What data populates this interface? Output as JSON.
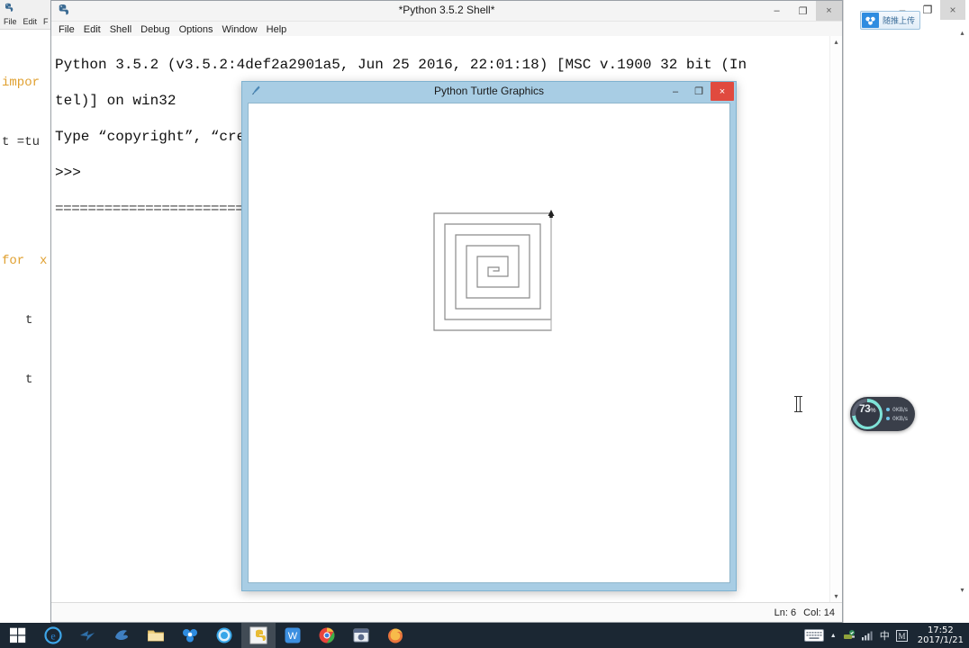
{
  "editor_window": {
    "title": "",
    "icon": "python-idle-icon",
    "menu": [
      "File",
      "Edit",
      "F"
    ],
    "code_lines": [
      {
        "text": "impor",
        "kw": true
      },
      {
        "text": "t =tu",
        "kw": false
      },
      {
        "text": "",
        "kw": false
      },
      {
        "text": "for  x",
        "kw": true
      },
      {
        "text": "t",
        "kw": false,
        "indent": true
      },
      {
        "text": "t",
        "kw": false,
        "indent": true
      }
    ]
  },
  "shell_window": {
    "icon": "python-idle-icon",
    "title": "*Python 3.5.2 Shell*",
    "menu": [
      "File",
      "Edit",
      "Shell",
      "Debug",
      "Options",
      "Window",
      "Help"
    ],
    "window_buttons": {
      "minimize": "–",
      "maximize": "❐",
      "close": "×"
    },
    "output_lines": [
      "Python 3.5.2 (v3.5.2:4def2a2901a5, Jun 25 2016, 22:01:18) [MSC v.1900 32 bit (In",
      "tel)] on win32",
      "Type “copyright”, “credits” or “license()” for more information.",
      ">>>",
      "================================ RESTART ================================"
    ],
    "restart_rule": "======================================================================",
    "status": {
      "line_label": "Ln: 6",
      "col_label": "Col: 14"
    },
    "scrollbar": {
      "up": "▴",
      "down": "▾"
    }
  },
  "turtle_window": {
    "icon": "turtle-pen-icon",
    "title": "Python Turtle Graphics",
    "window_buttons": {
      "minimize": "–",
      "maximize": "❐",
      "close": "×"
    },
    "drawing": {
      "name": "square-spiral",
      "stroke_color": "#8a8a8a",
      "background": "#ffffff",
      "turtle_cursor": "turtle-arrow-up"
    }
  },
  "baidu_pill": {
    "icon": "baidu-cloud-icon",
    "label": "随推上传"
  },
  "right_chrome": {
    "window_buttons": {
      "minimize": "–",
      "maximize": "❐",
      "close": "×"
    },
    "scrollbar": {
      "up": "▴",
      "down": "▾"
    }
  },
  "perf_widget": {
    "cpu_percent": "73",
    "percent_symbol": "%",
    "accent_color": "#7fe3d8",
    "net_up": "0KB/s",
    "net_down": "0KB/s"
  },
  "taskbar": {
    "start_label": "start-windows-icon",
    "items": [
      {
        "name": "internet-explorer-icon",
        "glyph": "e",
        "color": "#2a7fc9",
        "active": false
      },
      {
        "name": "foxmail-icon",
        "glyph": "✦",
        "color": "#2f6fa8",
        "active": false
      },
      {
        "name": "thunder-download-icon",
        "glyph": "◗",
        "color": "#3f7fc1",
        "active": false
      },
      {
        "name": "file-explorer-icon",
        "glyph": "▬",
        "color": "#e8c060",
        "active": false
      },
      {
        "name": "baidu-netdisk-icon",
        "glyph": "♣",
        "color": "#2e8ce0",
        "active": false
      },
      {
        "name": "qq-browser-icon",
        "glyph": "●",
        "color": "#38a6e8",
        "active": false
      },
      {
        "name": "python-idle-taskbar-icon",
        "glyph": "⌘",
        "color": "#f0d060",
        "active": true
      },
      {
        "name": "wps-writer-icon",
        "glyph": "W",
        "color": "#3c8fe0",
        "active": false
      },
      {
        "name": "google-chrome-icon",
        "glyph": "◉",
        "color": "#3bb14a",
        "active": false
      },
      {
        "name": "media-player-icon",
        "glyph": "▶",
        "color": "#5a6a8a",
        "active": false
      },
      {
        "name": "firefox-icon",
        "glyph": "◕",
        "color": "#e8743c",
        "active": false
      }
    ],
    "tray": {
      "keyboard": "on-screen-keyboard-icon",
      "show_hidden": "▲",
      "safely_remove": "⚑",
      "network": "▃",
      "ime_mode": "中",
      "ime_letter": "M",
      "time": "17:52",
      "date": "2017/1/21"
    }
  }
}
